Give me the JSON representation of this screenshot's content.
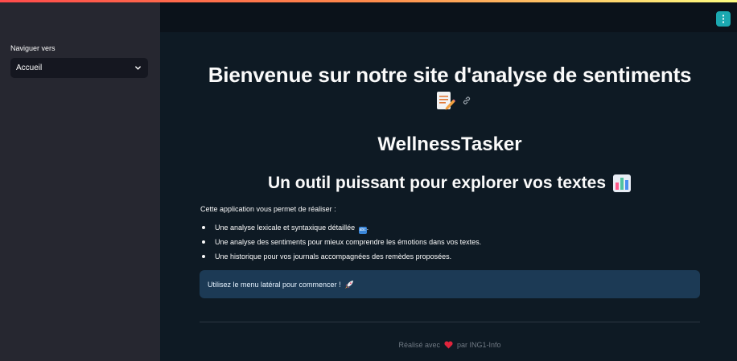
{
  "sidebar": {
    "nav_label": "Naviguer vers",
    "select_value": "Accueil"
  },
  "main": {
    "title": "Bienvenue sur notre site d'analyse de sentiments",
    "title_icon": "memo-icon",
    "app_name": "WellnessTasker",
    "subtitle": "Un outil puissant pour explorer vos textes",
    "subtitle_icon": "bar-chart-icon",
    "intro": "Cette application vous permet de réaliser :",
    "bullets": [
      "Une analyse lexicale et syntaxique détaillée",
      "Une analyse des sentiments pour mieux comprendre les émotions dans vos textes.",
      "Une historique pour vos journals accompagnées des remèdes proposées."
    ],
    "bullet_suffix": ".",
    "info": "Utilisez le menu latéral pour commencer !",
    "footer_prefix": "Réalisé avec",
    "footer_suffix": "par ING1-Info"
  },
  "colors": {
    "accent": "#1ba8b0",
    "info_bg": "#1c3a55",
    "sidebar_bg": "#262730",
    "main_bg": "#0e1a24"
  }
}
